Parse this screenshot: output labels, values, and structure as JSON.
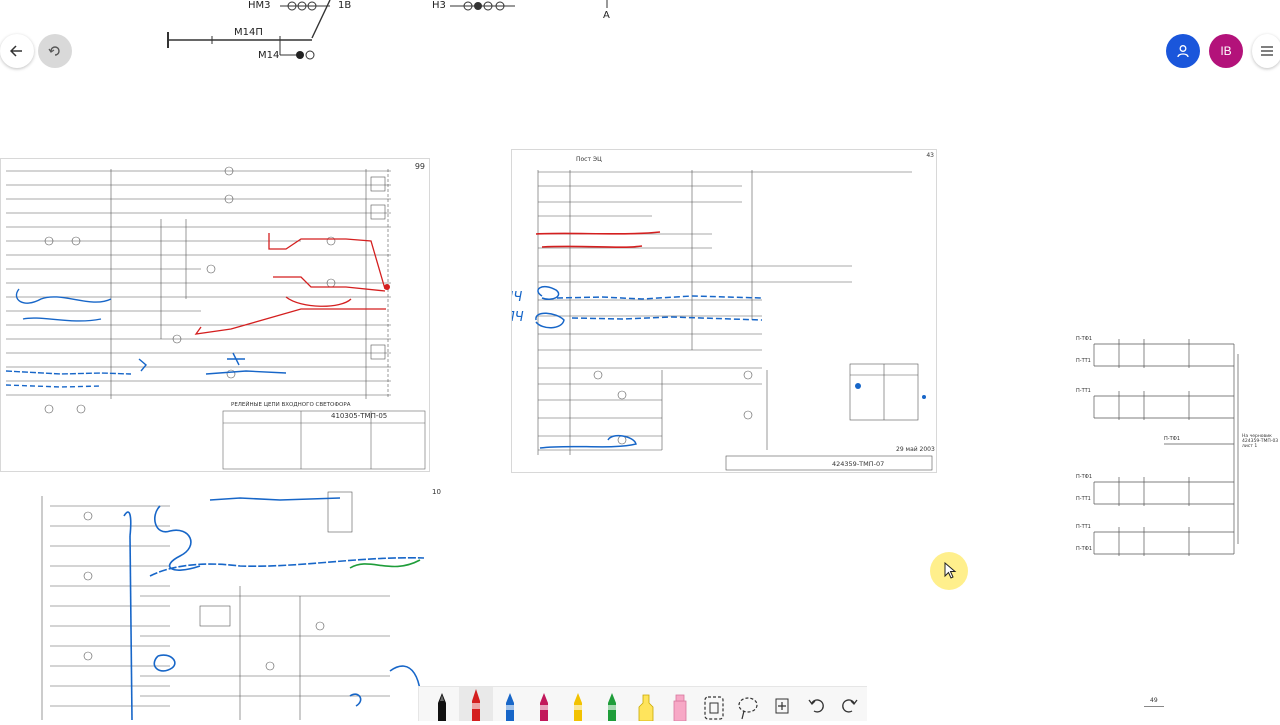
{
  "canvas": {
    "top_diagram": {
      "labels": [
        "НМ3",
        "1В",
        "Н3",
        "А",
        "М14П",
        "М14"
      ]
    },
    "sheet1": {
      "page_number": "99",
      "doc_code": "410305-ТМП-05",
      "title_text": "РЕЛЕЙНЫЕ ЦЕПИ ВХОДНОГО СВЕТОФОРА"
    },
    "sheet2": {
      "page_number": "43",
      "header": "Пост ЭЦ",
      "doc_code": "424359-ТМП-07",
      "date": "29 май 2003",
      "handwritten_notes": [
        "ППЛЧ",
        "ПМЛЧ"
      ]
    },
    "sheet3": {
      "page_number": "10"
    },
    "right_diagram": {
      "row_labels": [
        "П-ТФ1",
        "П-ТТ1",
        "П-ТТ1",
        "П-ТФ1",
        "П-ТФ1",
        "П-ТТ1",
        "П-ТТ1",
        "П-ТФ1"
      ],
      "note": "На черновик 424359-ТМП-03 лист 1"
    },
    "footer_page": "49"
  },
  "header_buttons": {
    "back_icon": "arrow-left-icon",
    "rotate_icon": "rotate-icon",
    "user_initials": "IB",
    "user_color": "#b3127a",
    "person_color": "#1a56db"
  },
  "toolbar": {
    "tools": [
      {
        "name": "pen-black-tool",
        "color": "#111111"
      },
      {
        "name": "pen-red-tool",
        "color": "#d41f1f"
      },
      {
        "name": "pen-blue-tool",
        "color": "#1766c8"
      },
      {
        "name": "pen-magenta-tool",
        "color": "#c2185b"
      },
      {
        "name": "pen-yellow-tool",
        "color": "#f2c200"
      },
      {
        "name": "pen-green-tool",
        "color": "#1f9d3a"
      },
      {
        "name": "highlighter-yellow-tool",
        "color": "#ffe45c"
      },
      {
        "name": "highlighter-pink-tool",
        "color": "#f7a8c6"
      },
      {
        "name": "eraser-tool",
        "color": "#333333"
      },
      {
        "name": "lasso-tool",
        "color": "#333333"
      },
      {
        "name": "insert-space-tool",
        "color": "#333333"
      },
      {
        "name": "undo-tool",
        "color": "#333333"
      },
      {
        "name": "redo-tool",
        "color": "#333333"
      }
    ]
  }
}
